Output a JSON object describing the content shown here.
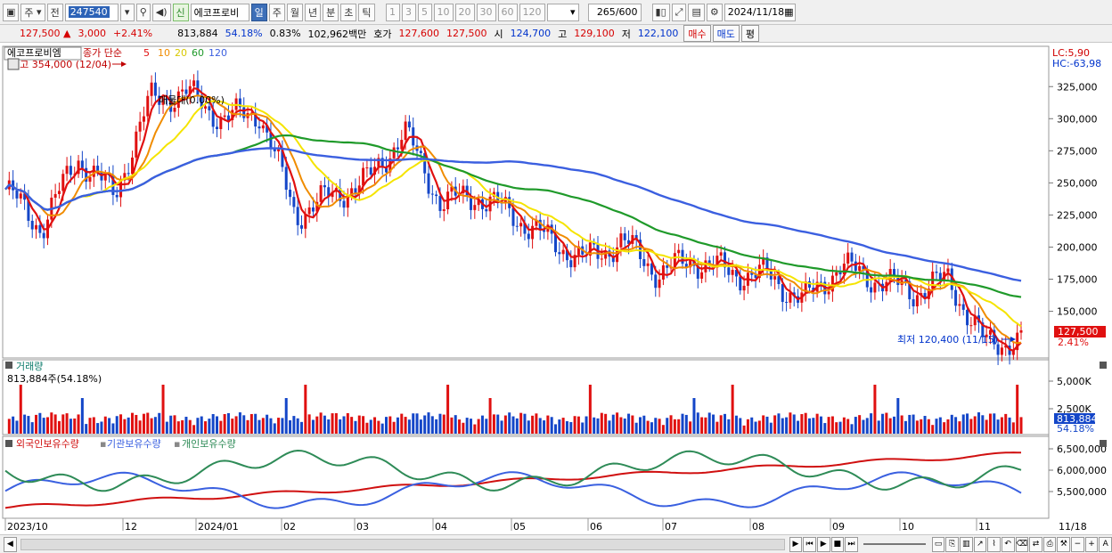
{
  "toolbar": {
    "period_main": "주",
    "period_alt": "전",
    "stock_code": "247540",
    "shin": "신",
    "stock_name": "에코프로비",
    "periods": [
      "일",
      "주",
      "월",
      "년",
      "분",
      "초",
      "틱"
    ],
    "active_period": "일",
    "intervals": [
      "1",
      "3",
      "5",
      "10",
      "20",
      "30",
      "60",
      "120"
    ],
    "count": "265",
    "count_total": "/600",
    "date": "2024/11/18"
  },
  "quote": {
    "price": "127,500",
    "arrow": "▲",
    "change": "3,000",
    "change_pct": "+2.41%",
    "volume": "813,884",
    "volume_ratio": "54.18%",
    "turnover": "0.83%",
    "amount": "102,962백만",
    "hoga_label": "호가",
    "ask": "127,600",
    "bid": "127,500",
    "open_label": "시",
    "open": "124,700",
    "high_label": "고",
    "high": "129,100",
    "low_label": "저",
    "low": "122,100",
    "buy_button": "매수",
    "sell_button": "매도",
    "avg_button": "평"
  },
  "chart": {
    "name_tag": "에코프로비엠",
    "legend_title": "종가 단순",
    "ma_periods": [
      "5",
      "10",
      "20",
      "60",
      "120"
    ],
    "lc": "LC:5,90",
    "hc": "HC:-63,98",
    "high_marker": "최고 354,000 (12/04)",
    "low_marker": "최저 120,400 (11/15)",
    "distribution_label": "매물대(0.00%)",
    "price_axis": [
      "325,000",
      "300,000",
      "275,000",
      "250,000",
      "225,000",
      "200,000",
      "175,000",
      "150,000"
    ],
    "last_price_tag": "127,500",
    "last_pct_tag": "2.41%",
    "volume_title": "거래량",
    "volume_info": "813,884주(54.18%)",
    "volume_axis": [
      "5,000K",
      "2,500K"
    ],
    "volume_tag": "813,884",
    "volume_pct_tag": "54.18%",
    "holdings_titles": [
      "외국인보유수량",
      "기관보유수량",
      "개인보유수량"
    ],
    "holdings_axis": [
      "6,500,000",
      "6,000,000",
      "5,500,000"
    ],
    "date_axis": [
      "2023/10",
      "12",
      "2024/01",
      "02",
      "03",
      "04",
      "05",
      "06",
      "07",
      "08",
      "09",
      "10",
      "11",
      "11/18"
    ]
  },
  "colors": {
    "ma5": "#e01010",
    "ma10": "#f08c00",
    "ma20": "#f5e400",
    "ma60": "#1f9a2a",
    "ma120": "#3b5fe0",
    "up_candle": "#e01010",
    "down_candle": "#1446c8",
    "foreign": "#d01010",
    "institution": "#3a60e0",
    "individual": "#2e8b57"
  },
  "chart_data": {
    "type": "candlestick",
    "ylim": [
      115000,
      355000
    ],
    "series_close": [
      {
        "date": "2023/10",
        "close": 245000
      },
      {
        "date": "2023/10b",
        "close": 215000
      },
      {
        "date": "2023/11",
        "close": 270000
      },
      {
        "date": "2023/11b",
        "close": 240000
      },
      {
        "date": "2023/12",
        "close": 315000
      },
      {
        "date": "2023/12b",
        "close": 320000
      },
      {
        "date": "2024/01",
        "close": 300000
      },
      {
        "date": "2024/01b",
        "close": 305000
      },
      {
        "date": "2024/02",
        "close": 225000
      },
      {
        "date": "2024/02b",
        "close": 240000
      },
      {
        "date": "2024/03",
        "close": 252000
      },
      {
        "date": "2024/03b",
        "close": 290000
      },
      {
        "date": "2024/04",
        "close": 235000
      },
      {
        "date": "2024/04b",
        "close": 240000
      },
      {
        "date": "2024/05",
        "close": 225000
      },
      {
        "date": "2024/05b",
        "close": 205000
      },
      {
        "date": "2024/06",
        "close": 190000
      },
      {
        "date": "2024/06b",
        "close": 205000
      },
      {
        "date": "2024/07",
        "close": 180000
      },
      {
        "date": "2024/07b",
        "close": 190000
      },
      {
        "date": "2024/08",
        "close": 180000
      },
      {
        "date": "2024/08b",
        "close": 178000
      },
      {
        "date": "2024/09",
        "close": 158000
      },
      {
        "date": "2024/09b",
        "close": 185000
      },
      {
        "date": "2024/10",
        "close": 175000
      },
      {
        "date": "2024/10b",
        "close": 165000
      },
      {
        "date": "2024/11",
        "close": 175000
      },
      {
        "date": "2024/11/15",
        "close": 124700
      },
      {
        "date": "2024/11/18",
        "close": 127500
      }
    ]
  }
}
